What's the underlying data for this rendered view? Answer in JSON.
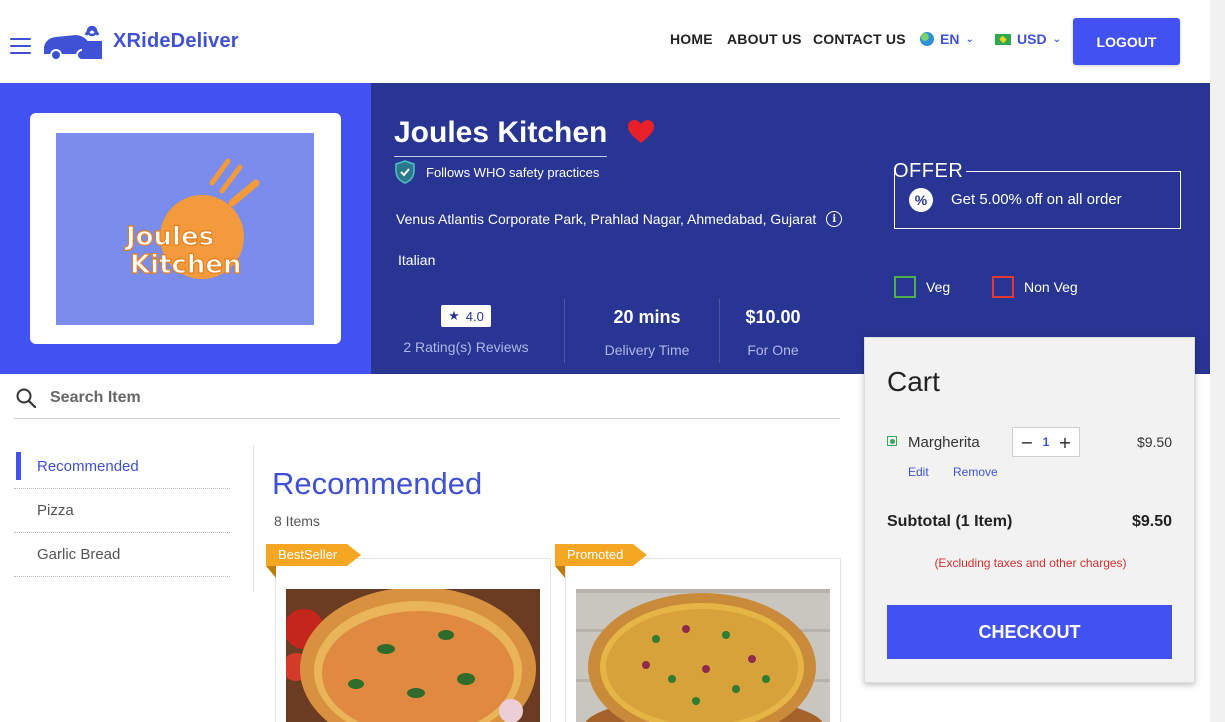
{
  "header": {
    "brand": "XRideDeliver",
    "nav": [
      "HOME",
      "ABOUT US",
      "CONTACT US"
    ],
    "language": "EN",
    "currency": "USD",
    "logout_label": "LOGOUT"
  },
  "restaurant": {
    "logo_text_1": "Joules",
    "logo_text_2": "Kitchen",
    "name": "Joules Kitchen",
    "safety_text": "Follows WHO safety practices",
    "address": "Venus Atlantis Corporate Park, Prahlad Nagar, Ahmedabad, Gujarat",
    "cuisine": "Italian",
    "rating": "4.0",
    "rating_label": "2 Rating(s) Reviews",
    "delivery_time": "20 mins",
    "delivery_label": "Delivery Time",
    "price": "$10.00",
    "price_label": "For One"
  },
  "offer": {
    "title": "OFFER",
    "text": "Get 5.00% off on all order"
  },
  "filters": {
    "veg": "Veg",
    "non_veg": "Non Veg"
  },
  "search": {
    "placeholder": "Search Item"
  },
  "categories": [
    "Recommended",
    "Pizza",
    "Garlic Bread"
  ],
  "section": {
    "title": "Recommended",
    "count": "8 Items"
  },
  "products": [
    {
      "badge": "BestSeller"
    },
    {
      "badge": "Promoted"
    }
  ],
  "cart": {
    "title": "Cart",
    "item_name": "Margherita",
    "quantity": "1",
    "item_price": "$9.50",
    "edit_label": "Edit",
    "remove_label": "Remove",
    "subtotal_label": "Subtotal (1 Item)",
    "subtotal_value": "$9.50",
    "tax_note": "(Excluding taxes and other charges)",
    "checkout_label": "CHECKOUT"
  },
  "colors": {
    "primary": "#4252f0",
    "hero_dark": "#283593",
    "badge": "#f5a623",
    "veg": "#4caf50",
    "non_veg": "#e53935"
  }
}
